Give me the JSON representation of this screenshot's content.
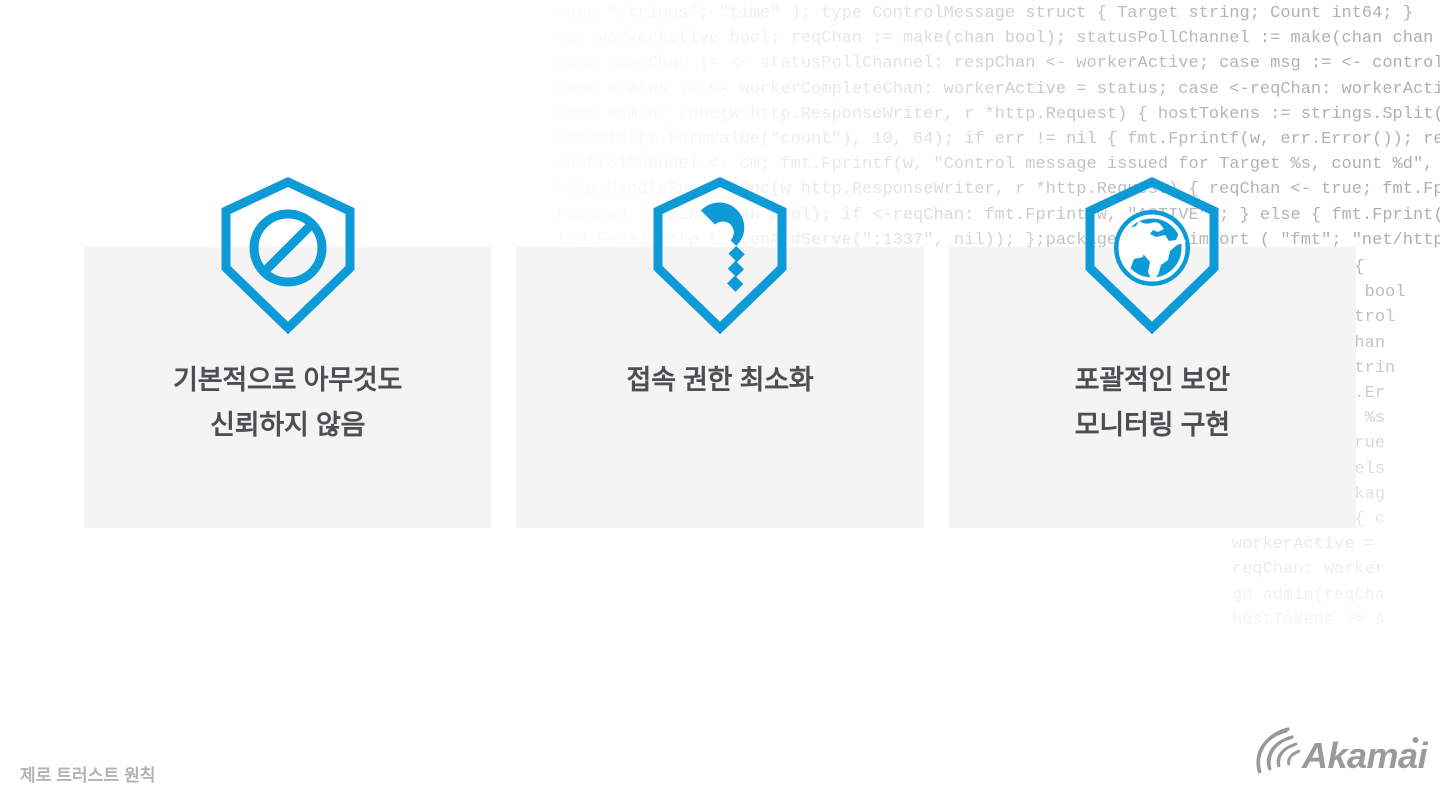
{
  "slide": {
    "footer_label": "제로 트러스트 원칙",
    "brand_name": "Akamai",
    "accent_color": "#0d9bd7",
    "card_bg_color": "#f4f4f4",
    "title_color": "#4d4d52",
    "footer_color": "#b3b3b3",
    "logo_color": "#9a9a9a"
  },
  "cards": [
    {
      "icon_name": "shield-prohibition-icon",
      "title": "기본적으로 아무것도\n신뢰하지 않음"
    },
    {
      "icon_name": "shield-key-icon",
      "title": "접속 권한 최소화"
    },
    {
      "icon_name": "shield-globe-icon",
      "title": "포괄적인 보안\n모니터링 구현"
    }
  ],
  "background_code": {
    "top_block": "name \"strings\"; \"time\" ); type ControlMessage struct { Target string; Count int64; }\nvar workerActive bool; reqChan := make(chan bool); statusPollChannel := make(chan chan bool); workerComp\ncase respChan := <- statusPollChannel: respChan <- workerActive; case msg := <- controlChannel: worke\ncase status := <- workerCompleteChan: workerActive = status; case <-reqChan: workerActive = true; go\nfunc admin( func(w http.ResponseWriter, r *http.Request) { hostTokens := strings.Split(r.Host, \":\")\nParseInt(r.FormValue(\"count\"), 10, 64); if err != nil { fmt.Fprintf(w, err.Error()); return; }; cm :=\ncontrolChannel <- cm; fmt.Fprintf(w, \"Control message issued for Target %s, count %d\", cm.Target, cm.\nhttp.HandleFunc( func(w http.ResponseWriter, r *http.Request) { reqChan <- true; fmt.Fprint(w, \"OK\")\nreqChan := make(chan bool); if <-reqChan: fmt.Fprint(w, \"ACTIVE\"); } else { fmt.Fprint(w, \"INACTIVE\")\nlog.Fatal(http.ListenAndServe(\":1337\", nil)); };package main; import ( \"fmt\"; \"net/http\"; \"strconv\"",
    "right_block": "func main() {\nworkerActive bool\nmsg := <-control\nc admin(reqChan\ntTokens := strin\nrintf(w, err.Er\nd for Target %s\nreqChan <- true\nACTIVE\"); } els\nnil)); };packag\nfunc main() { c\nworkerActive =\nreqChan: worker\ngo admin(reqCha\nhostTokens := s"
  }
}
